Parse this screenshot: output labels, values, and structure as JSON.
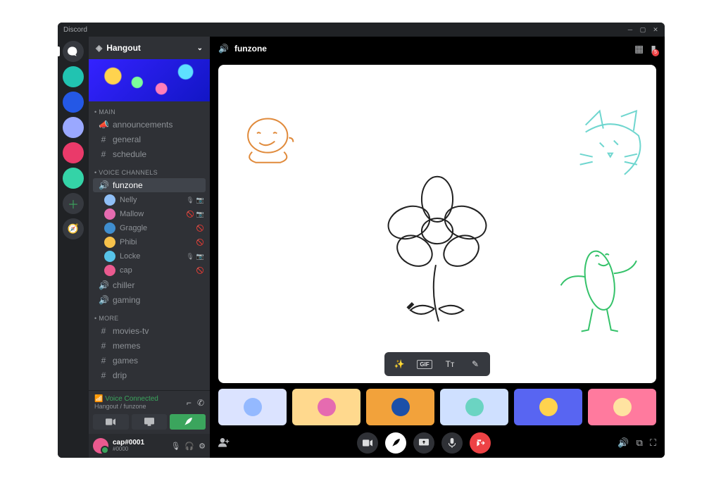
{
  "app_name": "Discord",
  "guild": {
    "name": "Hangout"
  },
  "sections": {
    "main": {
      "label": "MAIN",
      "channels": [
        {
          "icon": "megaphone",
          "name": "announcements"
        },
        {
          "icon": "hash",
          "name": "general"
        },
        {
          "icon": "hash",
          "name": "schedule"
        }
      ]
    },
    "voice": {
      "label": "VOICE CHANNELS",
      "channels": [
        {
          "name": "funzone",
          "active": true,
          "users": [
            {
              "name": "Nelly",
              "color": "#8fbff7",
              "mic": true,
              "cam": true
            },
            {
              "name": "Mallow",
              "color": "#e56bb0",
              "mic": false,
              "cam": true
            },
            {
              "name": "Graggle",
              "color": "#3f8ecf",
              "mic": false,
              "cam": false
            },
            {
              "name": "Phibi",
              "color": "#f7c24b",
              "mic": false,
              "cam": false
            },
            {
              "name": "Locke",
              "color": "#57c3e8",
              "mic": true,
              "cam": true
            },
            {
              "name": "cap",
              "color": "#ea5a8f",
              "mic": false,
              "cam": false
            }
          ]
        },
        {
          "name": "chiller"
        },
        {
          "name": "gaming"
        }
      ]
    },
    "more": {
      "label": "MORE",
      "channels": [
        {
          "icon": "hash",
          "name": "movies-tv"
        },
        {
          "icon": "hash",
          "name": "memes"
        },
        {
          "icon": "hash",
          "name": "games"
        },
        {
          "icon": "hash",
          "name": "drip"
        }
      ]
    }
  },
  "voice_status": {
    "title": "Voice Connected",
    "sub": "Hangout / funzone"
  },
  "current_user": {
    "name": "cap",
    "discrim": "#0001",
    "tag_line": "#0000"
  },
  "channel_header": {
    "name": "funzone",
    "inbox_badge": "5"
  },
  "whiteboard_tools": {
    "magic": "magic",
    "gif": "GIF",
    "text": "Tᴛ",
    "draw": "pencil"
  },
  "participant_tiles": [
    {
      "bg": "#dbe3ff",
      "dot": "#94b9ff"
    },
    {
      "bg": "#ffd98e",
      "dot": "#e56bb0"
    },
    {
      "bg": "#f2a23b",
      "dot": "#1c50a8"
    },
    {
      "bg": "#cfe0ff",
      "dot": "#6bd4c2"
    },
    {
      "bg": "#5865f2",
      "dot": "#ffd34e"
    },
    {
      "bg": "#ff7a9e",
      "dot": "#ffe3a1"
    }
  ],
  "call_controls": {
    "camera": "camera",
    "activity": "rocket",
    "screen": "screen-share",
    "mic": "mic",
    "leave": "leave"
  },
  "right_call_icons": {
    "volume": "volume",
    "popout": "popout",
    "fullscreen": "fullscreen"
  },
  "voice_action_buttons": {
    "video": "video",
    "screen": "screen",
    "rocket": "rocket"
  },
  "server_rail": [
    {
      "kind": "home"
    },
    {
      "kind": "server",
      "bg": "#21c3b1"
    },
    {
      "kind": "server",
      "bg": "#2458e6"
    },
    {
      "kind": "server",
      "bg": "#9aa8ff"
    },
    {
      "kind": "server",
      "bg": "#ea3a6a"
    },
    {
      "kind": "server",
      "bg": "#34d3a7"
    },
    {
      "kind": "add"
    },
    {
      "kind": "explore"
    }
  ]
}
